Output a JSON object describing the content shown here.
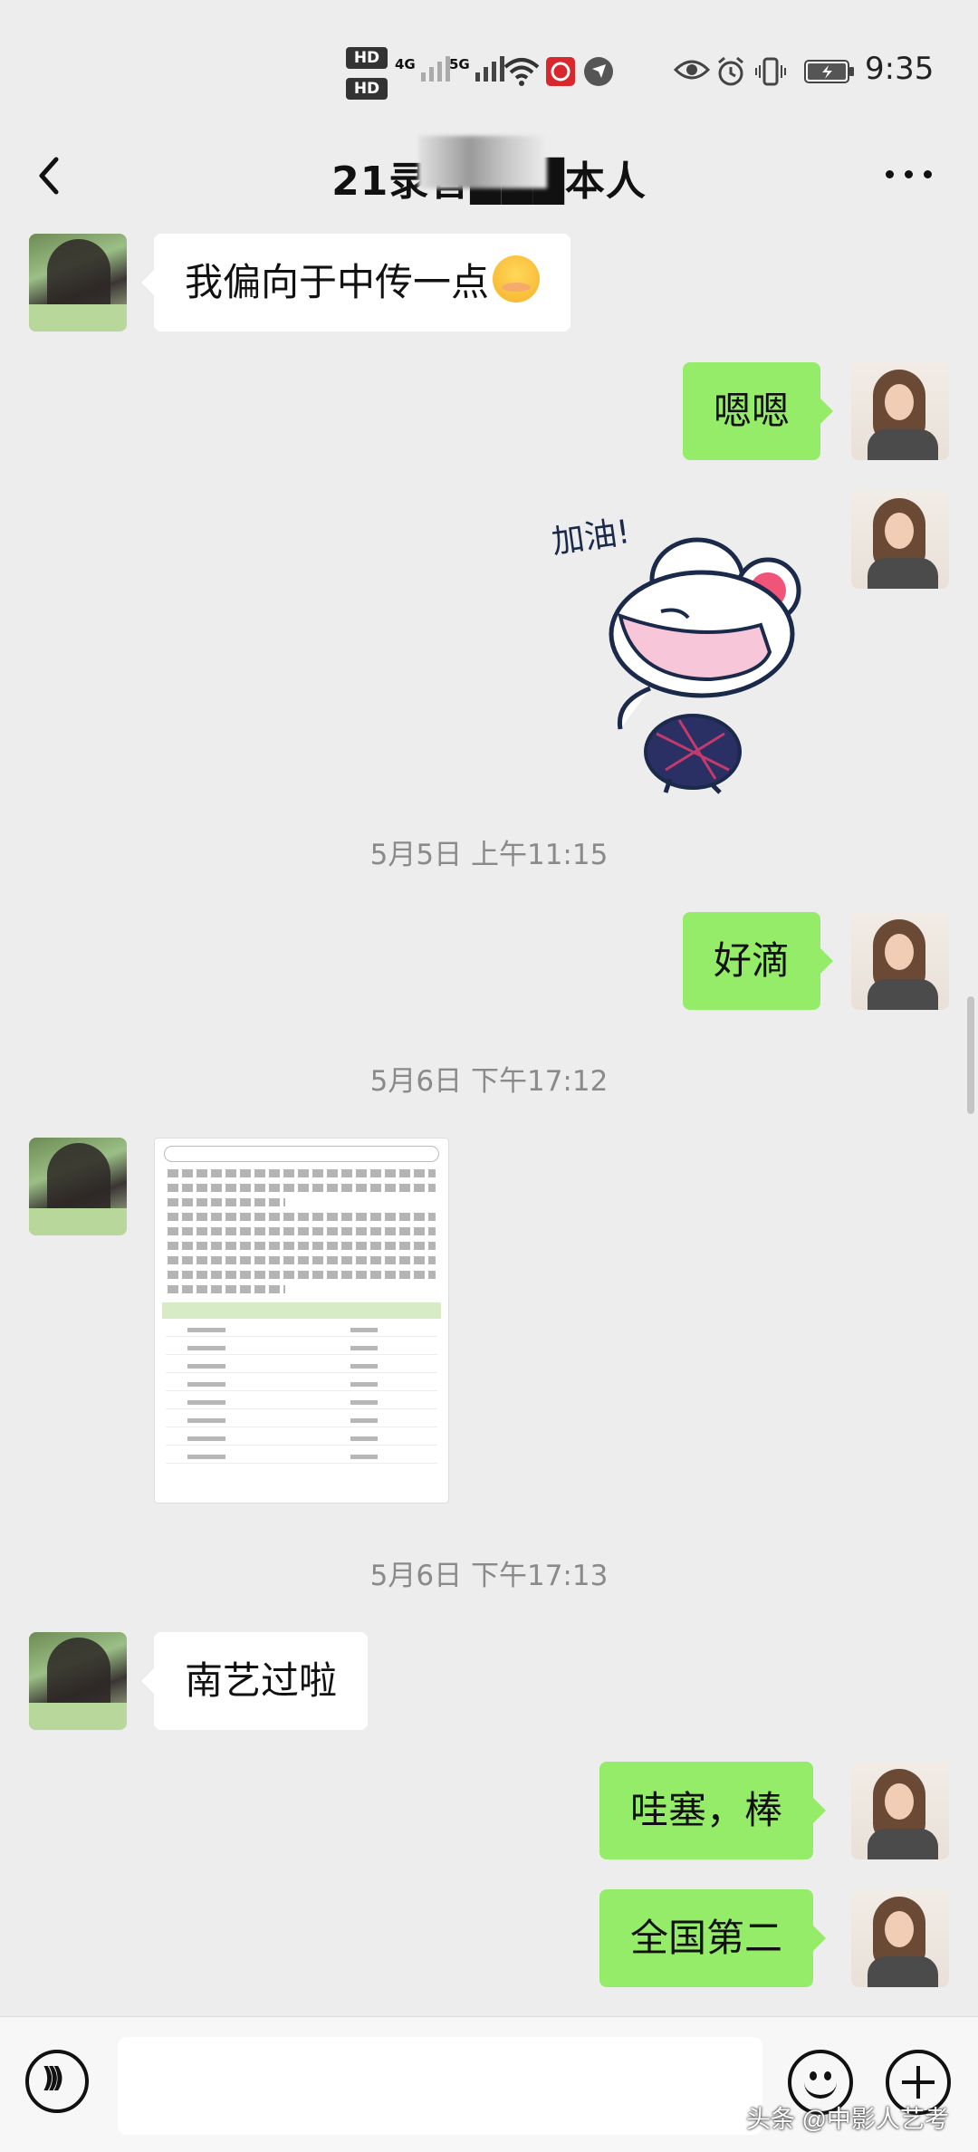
{
  "status_bar": {
    "hd1": "HD",
    "hd2": "HD",
    "net1": "4G",
    "net2": "5G",
    "time": "9:35",
    "icons": [
      "hd-icon",
      "signal-icon",
      "wifi-icon",
      "app-notification-icon",
      "location-icon",
      "eye-icon",
      "alarm-icon",
      "vibrate-icon",
      "battery-icon"
    ]
  },
  "header": {
    "title": "21录音███本人",
    "back_icon": "chevron-left-icon",
    "more_icon": "more-dots-icon"
  },
  "messages": [
    {
      "side": "left",
      "type": "text",
      "text": "我偏向于中传一点",
      "emoji": "shy-face-emoji"
    },
    {
      "side": "right",
      "type": "text",
      "text": "嗯嗯"
    },
    {
      "side": "right",
      "type": "sticker",
      "sticker_text": "加油!"
    },
    {
      "type": "timestamp",
      "text": "5月5日 上午11:15"
    },
    {
      "side": "right",
      "type": "text",
      "text": "好滴"
    },
    {
      "type": "timestamp",
      "text": "5月6日 下午17:12"
    },
    {
      "side": "left",
      "type": "image",
      "image_desc": "exam-result-screenshot"
    },
    {
      "type": "timestamp",
      "text": "5月6日 下午17:13"
    },
    {
      "side": "left",
      "type": "text",
      "text": "南艺过啦"
    },
    {
      "side": "right",
      "type": "text",
      "text": "哇塞，棒"
    },
    {
      "side": "right",
      "type": "text",
      "text": "全国第二"
    }
  ],
  "input_bar": {
    "voice_icon": "voice-icon",
    "emoji_icon": "emoji-icon",
    "plus_icon": "plus-icon",
    "value": ""
  },
  "watermark": "头条 @中影人艺考",
  "colors": {
    "background": "#ededed",
    "bubble_right": "#95ec69",
    "bubble_left": "#ffffff"
  }
}
